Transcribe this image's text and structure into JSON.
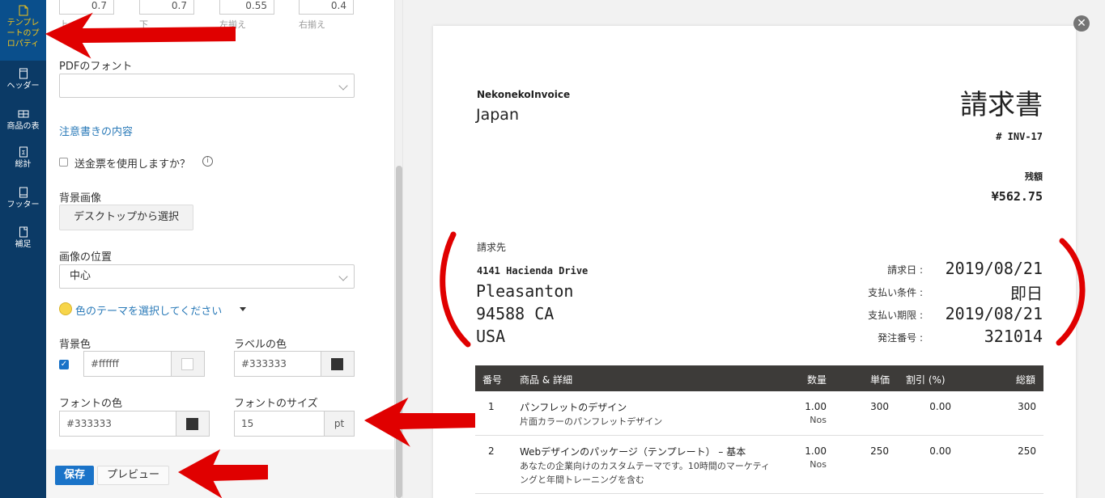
{
  "sidebar": {
    "items": [
      {
        "label": "テンプレートのプロパティ",
        "lines": [
          "テンプレ",
          "ートのプ",
          "ロパティ"
        ],
        "icon": "document-icon"
      },
      {
        "label": "ヘッダー",
        "icon": "header-icon"
      },
      {
        "label": "商品の表",
        "icon": "table-icon"
      },
      {
        "label": "総計",
        "icon": "sigma-icon"
      },
      {
        "label": "フッター",
        "icon": "footer-icon"
      },
      {
        "label": "補足",
        "icon": "note-icon"
      }
    ]
  },
  "margins": {
    "values": [
      "0.7",
      "0.7",
      "0.55",
      "0.4"
    ],
    "labels": [
      "上",
      "下",
      "左揃え",
      "右揃え"
    ]
  },
  "pdf_font": {
    "label": "PDFのフォント",
    "value": ""
  },
  "notes_link": "注意書きの内容",
  "remittance": {
    "label": "送金票を使用しますか？",
    "checked": false,
    "info_icon": "info-icon"
  },
  "background_image": {
    "label": "背景画像",
    "button": "デスクトップから選択"
  },
  "image_position": {
    "label": "画像の位置",
    "value": "中心"
  },
  "theme_link": "色のテーマを選択してください",
  "bg_color": {
    "label": "背景色",
    "checked": true,
    "value": "#ffffff",
    "swatch": "#ffffff"
  },
  "label_color": {
    "label": "ラベルの色",
    "value": "#333333",
    "swatch": "#333333"
  },
  "font_color": {
    "label": "フォントの色",
    "value": "#333333",
    "swatch": "#333333"
  },
  "font_size": {
    "label": "フォントのサイズ",
    "value": "15",
    "unit": "pt"
  },
  "footer": {
    "save": "保存",
    "preview": "プレビュー"
  },
  "invoice": {
    "company": "NekonekoInvoice",
    "country": "Japan",
    "title": "請求書",
    "number": "# INV-17",
    "balance_label": "残額",
    "balance": "¥562.75",
    "bill_to_label": "請求先",
    "address": {
      "street": "4141 Hacienda Drive",
      "city": "Pleasanton",
      "zip": "94588 CA",
      "country": "USA"
    },
    "meta": [
      {
        "label": "請求日 :",
        "value": "2019/08/21"
      },
      {
        "label": "支払い条件 :",
        "value": "即日"
      },
      {
        "label": "支払い期限 :",
        "value": "2019/08/21"
      },
      {
        "label": "発注番号 :",
        "value": "321014"
      }
    ],
    "table": {
      "headers": [
        "番号",
        "商品 & 詳細",
        "数量",
        "単価",
        "割引 (%)",
        "総額"
      ],
      "rows": [
        {
          "no": "1",
          "name": "パンフレットのデザイン",
          "desc": [
            "片面カラーのパンフレットデザイン"
          ],
          "qty": "1.00",
          "unit": "Nos",
          "price": "300",
          "discount": "0.00",
          "total": "300"
        },
        {
          "no": "2",
          "name": "Webデザインのパッケージ（テンプレート） – 基本",
          "desc": [
            "あなたの企業向けのカスタムテーマです。10時間のマーケティ",
            "ングと年間トレーニングを含む"
          ],
          "qty": "1.00",
          "unit": "Nos",
          "price": "250",
          "discount": "0.00",
          "total": "250"
        }
      ]
    }
  },
  "colors": {
    "sidebar": "#0b3a66",
    "active_text": "#f5c518",
    "link": "#2a7ab8",
    "primary_button": "#1a73c8",
    "table_header": "#3d3b39",
    "annotation": "#e00000"
  }
}
